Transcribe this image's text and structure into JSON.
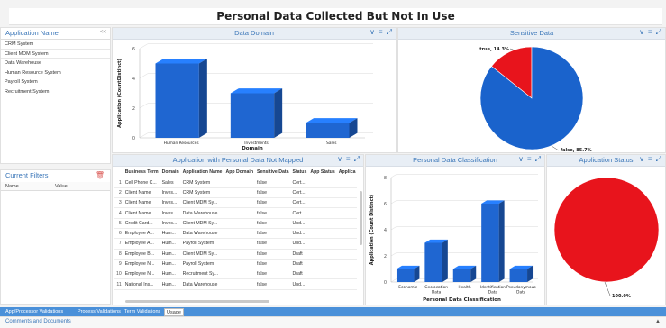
{
  "page": {
    "title": "Personal Data Collected But Not In Use"
  },
  "app_name_panel": {
    "title": "Application Name",
    "collapse": "<<",
    "items": [
      "CRM System",
      "Client MDM System",
      "Data Warehouse",
      "Human Resource System",
      "Payroll System",
      "Recruitment System"
    ]
  },
  "filters": {
    "title": "Current Filters",
    "col_name": "Name",
    "col_value": "Value"
  },
  "data_domain": {
    "title": "Data Domain",
    "chart_data": {
      "type": "bar",
      "categories": [
        "Human Resources",
        "Investments",
        "Sales"
      ],
      "values": [
        5,
        3,
        1
      ],
      "xlabel": "Domain",
      "ylabel": "Application (CountDistinct)",
      "ylim": [
        0,
        6
      ],
      "yticks": [
        0,
        2,
        4,
        6
      ],
      "color": "#1f66d1"
    }
  },
  "sensitive_data": {
    "title": "Sensitive Data",
    "chart_data": {
      "type": "pie",
      "labels": [
        "true",
        "false"
      ],
      "values": [
        14.3,
        85.7
      ],
      "display": [
        "true, 14.3%",
        "false, 85.7%"
      ],
      "colors": [
        "#e8141c",
        "#1a63cc"
      ]
    }
  },
  "table": {
    "title": "Application with Personal Data Not Mapped",
    "columns": [
      "",
      "Business Term",
      "Domain",
      "Application Name",
      "App Domain",
      "Sensitive Data",
      "Status",
      "App Status",
      "Applica"
    ],
    "rows": [
      [
        "1",
        "Cell Phone C...",
        "Sales",
        "CRM System",
        "",
        "false",
        "Cert...",
        "",
        ""
      ],
      [
        "2",
        "Client Name",
        "Inves...",
        "CRM System",
        "",
        "false",
        "Cert...",
        "",
        ""
      ],
      [
        "3",
        "Client Name",
        "Inves...",
        "Client MDM Sy...",
        "",
        "false",
        "Cert...",
        "",
        ""
      ],
      [
        "4",
        "Client Name",
        "Inves...",
        "Data Warehouse",
        "",
        "false",
        "Cert...",
        "",
        ""
      ],
      [
        "5",
        "Credit Card...",
        "Inves...",
        "Client MDM Sy...",
        "",
        "false",
        "Und...",
        "",
        ""
      ],
      [
        "6",
        "Employee A...",
        "Hum...",
        "Data Warehouse",
        "",
        "false",
        "Und...",
        "",
        ""
      ],
      [
        "7",
        "Employee A...",
        "Hum...",
        "Payroll System",
        "",
        "false",
        "Und...",
        "",
        ""
      ],
      [
        "8",
        "Employee B...",
        "Hum...",
        "Client MDM Sy...",
        "",
        "false",
        "Draft",
        "",
        ""
      ],
      [
        "9",
        "Employee N...",
        "Hum...",
        "Payroll System",
        "",
        "false",
        "Draft",
        "",
        ""
      ],
      [
        "10",
        "Employee N...",
        "Hum...",
        "Recruitment Sy...",
        "",
        "false",
        "Draft",
        "",
        ""
      ],
      [
        "11",
        "National Ins...",
        "Hum...",
        "Data Warehouse",
        "",
        "false",
        "Und...",
        "",
        ""
      ]
    ]
  },
  "classification": {
    "title": "Personal Data Classification",
    "chart_data": {
      "type": "bar",
      "categories": [
        "Economic",
        "Geolocation Data",
        "Health",
        "Identification Data",
        "Pseudonymous Data"
      ],
      "values": [
        1,
        3,
        1,
        6,
        1
      ],
      "xlabel": "Personal Data Classification",
      "ylabel": "Application (Count Distinct)",
      "ylim": [
        0,
        8
      ],
      "yticks": [
        0,
        2,
        4,
        6,
        8
      ],
      "color": "#1f66d1"
    }
  },
  "app_status": {
    "title": "Application Status",
    "chart_data": {
      "type": "pie",
      "labels": [
        ""
      ],
      "values": [
        100
      ],
      "display": [
        "100.0%"
      ],
      "colors": [
        "#e8141c"
      ]
    }
  },
  "tools": {
    "chevron": "∨",
    "menu": "≡",
    "expand": "⤢"
  },
  "tabs": [
    "App/Processor Validations",
    "Process Validations",
    "Term Validations",
    "Usage"
  ],
  "active_tab": "Usage",
  "comments": {
    "label": "Comments and Documents"
  }
}
